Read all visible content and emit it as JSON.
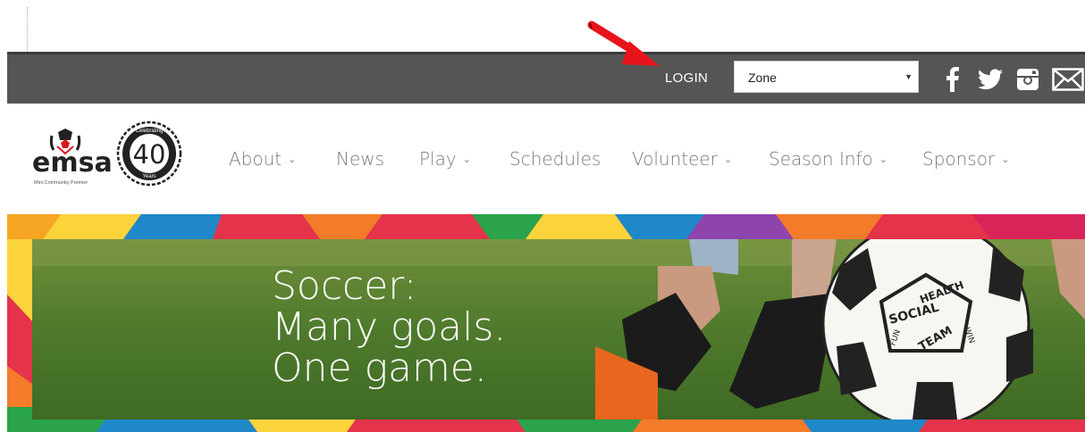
{
  "topbar": {
    "login_label": "LOGIN",
    "zone_select": {
      "selected": "Zone"
    },
    "social": [
      "facebook-icon",
      "twitter-icon",
      "instagram-icon",
      "email-icon"
    ],
    "colors": {
      "bar": "#555555",
      "arrow": "#e8141b"
    }
  },
  "brand": {
    "name": "emsa",
    "tagline": "Mini Community Premier",
    "badge_top": "Celebrating",
    "badge_number": "40",
    "badge_bottom": "Years"
  },
  "nav": {
    "items": [
      {
        "label": "About",
        "dropdown": true
      },
      {
        "label": "News",
        "dropdown": false
      },
      {
        "label": "Play",
        "dropdown": true
      },
      {
        "label": "Schedules",
        "dropdown": false
      },
      {
        "label": "Volunteer",
        "dropdown": true
      },
      {
        "label": "Season Info",
        "dropdown": true
      },
      {
        "label": "Sponsor",
        "dropdown": true
      }
    ]
  },
  "hero": {
    "line1": "Soccer:",
    "line2": "Many goals.",
    "line3": "One game.",
    "ball_words": [
      "HEALTH",
      "SOCIAL",
      "TEAM",
      "FUN",
      "WIN"
    ]
  }
}
